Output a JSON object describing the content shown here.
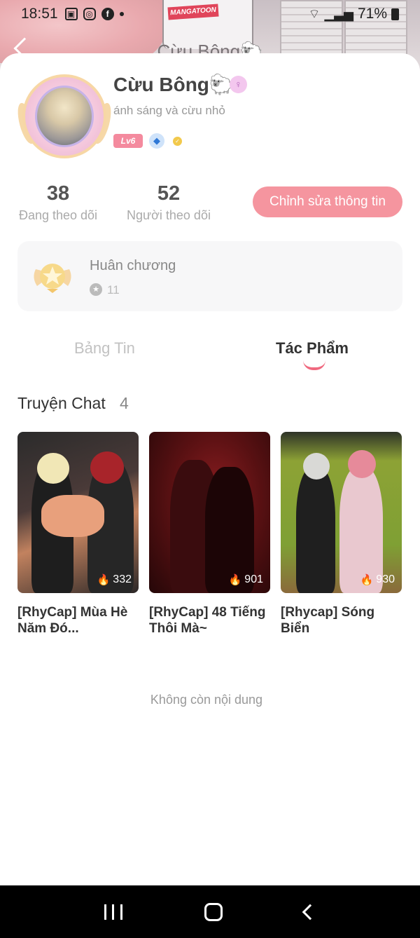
{
  "status_bar": {
    "time": "18:51",
    "battery": "71%"
  },
  "header": {
    "title": "Cừu Bông🐑"
  },
  "profile": {
    "name": "Cừu Bông🐑",
    "bio": "ánh sáng và cừu nhỏ",
    "level": "Lv6",
    "gender_icon": "female-icon"
  },
  "stats": {
    "following_count": "38",
    "following_label": "Đang theo dõi",
    "followers_count": "52",
    "followers_label": "Người theo dõi"
  },
  "edit_button_label": "Chỉnh sửa thông tin",
  "medal": {
    "title": "Huân chương",
    "count": "11"
  },
  "tabs": {
    "feed": "Bảng Tin",
    "works": "Tác Phẩm",
    "active": "works"
  },
  "section": {
    "title": "Truyện Chat",
    "count": "4"
  },
  "stories": [
    {
      "title": "[RhyCap] Mùa Hè Năm Đó...",
      "views": "332"
    },
    {
      "title": "[RhyCap] 48 Tiếng Thôi Mà~",
      "views": "901"
    },
    {
      "title": "[Rhycap] Sóng Biển",
      "views": "930"
    }
  ],
  "footer_text": "Không còn nội dung",
  "colors": {
    "accent": "#f5959f",
    "tab_indicator": "#f0697f",
    "level_badge": "#f48a9e"
  }
}
